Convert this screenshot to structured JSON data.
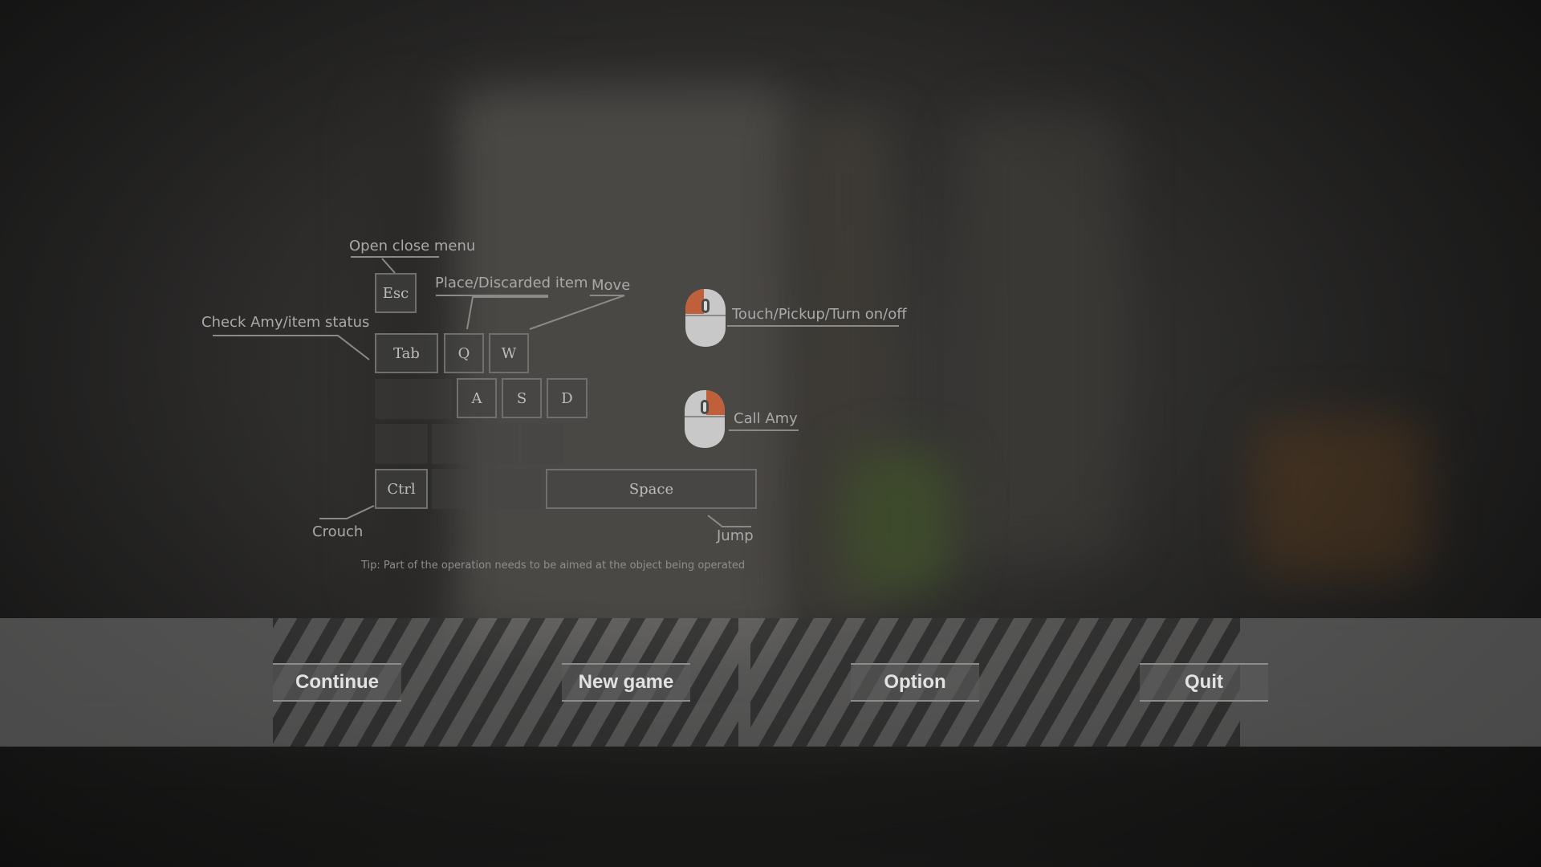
{
  "keys": {
    "esc": "Esc",
    "tab": "Tab",
    "q": "Q",
    "w": "W",
    "a": "A",
    "s": "S",
    "d": "D",
    "ctrl": "Ctrl",
    "space": "Space"
  },
  "labels": {
    "open_close_menu": "Open close menu",
    "place_discard": "Place/Discarded item",
    "move": "Move",
    "check_amy": "Check Amy/item status",
    "crouch": "Crouch",
    "jump": "Jump",
    "left_click": "Touch/Pickup/Turn on/off",
    "right_click": "Call Amy"
  },
  "tip": "Tip: Part of the operation needs to be aimed at the object being operated",
  "menu": {
    "continue": "Continue",
    "new_game": "New game",
    "option": "Option",
    "quit": "Quit"
  },
  "colors": {
    "mouse_highlight": "#c0603a",
    "mouse_body": "#c8c8c8"
  },
  "icons": {
    "left_mouse": "mouse-left-click-icon",
    "right_mouse": "mouse-right-click-icon"
  }
}
